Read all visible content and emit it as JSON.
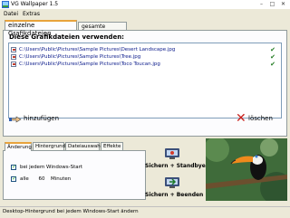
{
  "window": {
    "title": "VG Wallpaper 1.5"
  },
  "menu": {
    "items": [
      "Datei",
      "Extras"
    ]
  },
  "top_tabs": [
    {
      "label": "einzelne Grafikdateien",
      "active": true
    },
    {
      "label": "gesamte Ordner",
      "active": false
    }
  ],
  "files_panel": {
    "heading": "Diese Grafikdateien verwenden:",
    "files": [
      "C:\\Users\\Public\\Pictures\\Sample Pictures\\Desert Landscape.jpg",
      "C:\\Users\\Public\\Pictures\\Sample Pictures\\Tree.jpg",
      "C:\\Users\\Public\\Pictures\\Sample Pictures\\Toco Toucan.jpg"
    ],
    "add_label": "hinzufügen",
    "delete_label": "löschen"
  },
  "bottom_tabs": [
    {
      "label": "Änderung",
      "active": true
    },
    {
      "label": "Hintergrund",
      "active": false
    },
    {
      "label": "Dateiauswahl",
      "active": false
    },
    {
      "label": "Effekte",
      "active": false
    }
  ],
  "change_settings": {
    "on_start_label": "bei jedem Windows-Start",
    "interval_prefix": "alle",
    "interval_value": "60",
    "interval_unit": "Minuten"
  },
  "buttons": {
    "save_standby": "Sichern + Standbye",
    "save_exit": "Sichern + Beenden"
  },
  "status_text": "Desktop-Hintergrund bei jedem Windows-Start ändern",
  "colors": {
    "accent": "#e8a33c",
    "link": "#0a1a8a",
    "check": "#1f7a1f",
    "delete": "#c8201c"
  }
}
